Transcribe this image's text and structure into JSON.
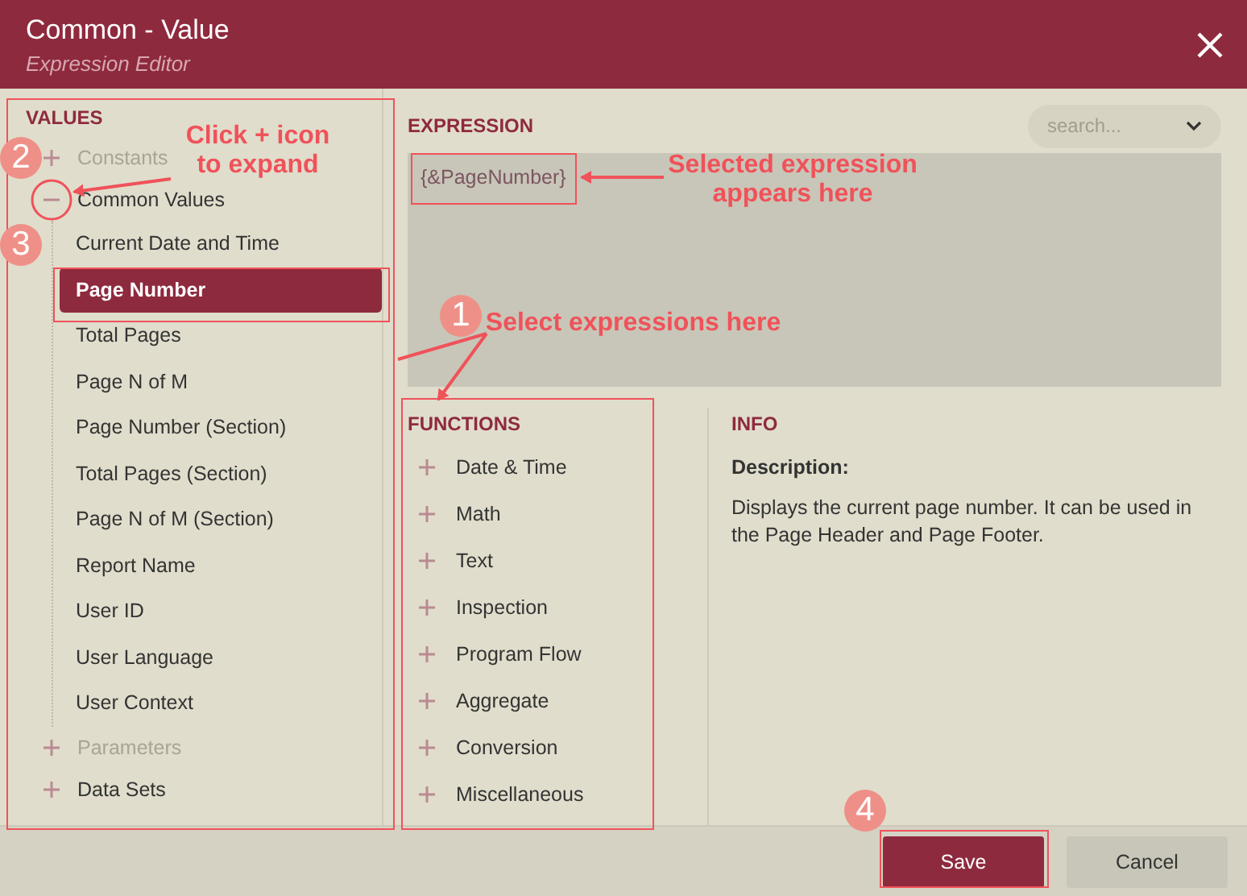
{
  "window": {
    "title": "Common - Value",
    "subtitle": "Expression Editor"
  },
  "values": {
    "heading": "VALUES",
    "items": [
      {
        "label": "Constants",
        "expanded": false,
        "disabled": true
      },
      {
        "label": "Common Values",
        "expanded": true,
        "disabled": false,
        "children": [
          {
            "label": "Current Date and Time",
            "selected": false
          },
          {
            "label": "Page Number",
            "selected": true
          },
          {
            "label": "Total Pages",
            "selected": false
          },
          {
            "label": "Page N of M",
            "selected": false
          },
          {
            "label": "Page Number (Section)",
            "selected": false
          },
          {
            "label": "Total Pages (Section)",
            "selected": false
          },
          {
            "label": "Page N of M (Section)",
            "selected": false
          },
          {
            "label": "Report Name",
            "selected": false
          },
          {
            "label": "User ID",
            "selected": false
          },
          {
            "label": "User Language",
            "selected": false
          },
          {
            "label": "User Context",
            "selected": false
          }
        ]
      },
      {
        "label": "Parameters",
        "expanded": false,
        "disabled": true
      },
      {
        "label": "Data Sets",
        "expanded": false,
        "disabled": false
      }
    ]
  },
  "expression": {
    "heading": "EXPRESSION",
    "search": {
      "placeholder": "search..."
    },
    "value": "{&PageNumber}"
  },
  "functions": {
    "heading": "FUNCTIONS",
    "items": [
      {
        "label": "Date & Time",
        "expanded": false
      },
      {
        "label": "Math",
        "expanded": false
      },
      {
        "label": "Text",
        "expanded": false
      },
      {
        "label": "Inspection",
        "expanded": false
      },
      {
        "label": "Program Flow",
        "expanded": false
      },
      {
        "label": "Aggregate",
        "expanded": false
      },
      {
        "label": "Conversion",
        "expanded": false
      },
      {
        "label": "Miscellaneous",
        "expanded": false
      }
    ]
  },
  "info": {
    "heading": "INFO",
    "description_label": "Description:",
    "description": "Displays the current page number. It can be used in the Page Header and Page Footer."
  },
  "buttons": [
    {
      "label": "Save",
      "kind": "primary"
    },
    {
      "label": "Cancel",
      "kind": "secondary"
    }
  ],
  "callouts": [
    {
      "kind": "badge",
      "text": "1"
    },
    {
      "kind": "badge",
      "text": "2"
    },
    {
      "kind": "badge",
      "text": "3"
    },
    {
      "kind": "badge",
      "text": "4"
    },
    {
      "kind": "note",
      "text": "Click + icon to expand"
    },
    {
      "kind": "note",
      "text": "Selected expression appears here"
    },
    {
      "kind": "note",
      "text": "Select expressions here"
    }
  ]
}
